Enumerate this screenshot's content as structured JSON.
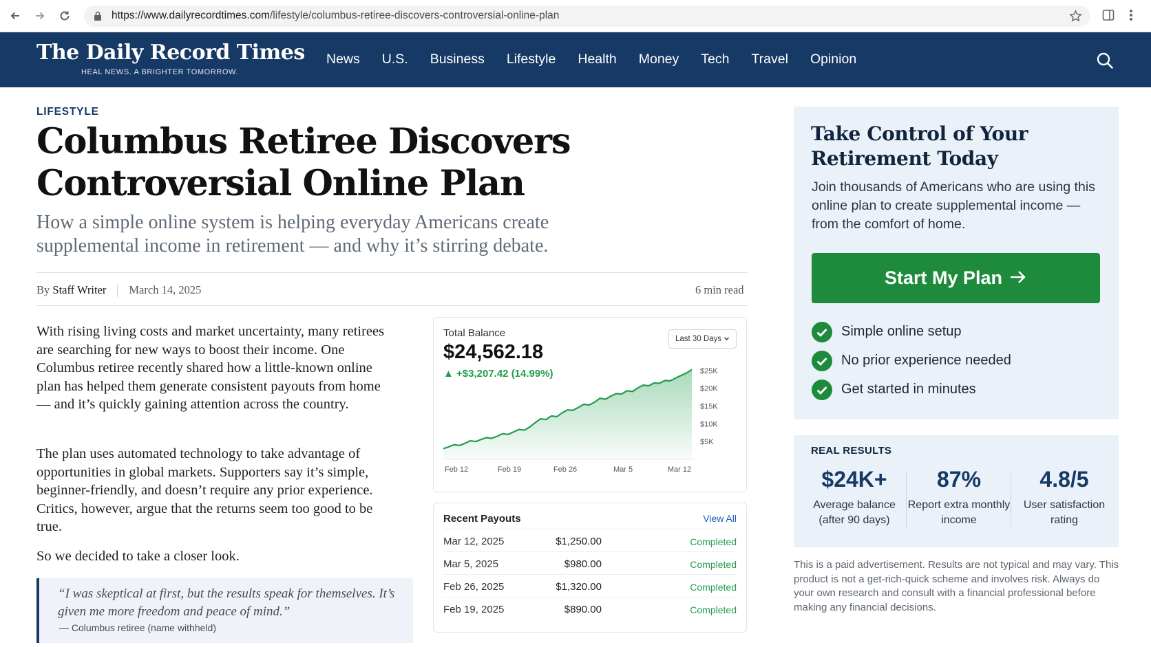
{
  "browser": {
    "url_host": "https://www.dailyrecordtimes.com",
    "url_path": "/lifestyle/columbus-retiree-discovers-controversial-online-plan"
  },
  "site": {
    "name": "The Daily Record Times",
    "tagline": "HEAL NEWS. A BRIGHTER TOMORROW.",
    "nav": [
      "News",
      "U.S.",
      "Business",
      "Lifestyle",
      "Health",
      "Money",
      "Tech",
      "Travel",
      "Opinion"
    ]
  },
  "article": {
    "kicker": "LIFESTYLE",
    "headline": "Columbus Retiree Discovers Controversial Online Plan",
    "subhead": "How a simple online system is helping everyday Americans create supplemental income in retirement — and why it’s stirring debate.",
    "by": "By",
    "author": "Staff Writer",
    "date": "March 14, 2025",
    "read_time": "6 min read",
    "paragraphs": [
      "With rising living costs and market uncertainty, many retirees are searching for new ways to boost their income. One Columbus retiree recently shared how a little-known online plan has helped them generate consistent payouts from home — and it’s quickly gaining attention across the country.",
      "The plan uses automated technology to take advantage of opportunities in global markets. Supporters say it’s simple, beginner-friendly, and doesn’t require any prior experience. Critics, however, argue that the returns seem too good to be true.",
      "So we decided to take a closer look."
    ],
    "quote": "“I was skeptical at first, but the results speak for themselves. It’s given me more freedom and peace of mind.”",
    "quote_attribution": "— Columbus retiree (name withheld)"
  },
  "balance_card": {
    "label": "Total Balance",
    "value": "$24,562.18",
    "change": "+$3,207.42 (14.99%)",
    "range": "Last 30 Days"
  },
  "chart_data": {
    "type": "area",
    "x_ticks": [
      "Feb 12",
      "Feb 19",
      "Feb 26",
      "Mar 5",
      "Mar 12"
    ],
    "y_ticks": [
      "$25K",
      "$20K",
      "$15K",
      "$10K",
      "$5K"
    ],
    "ylim": [
      0,
      27500
    ],
    "grid": false,
    "y_axis_side": "right",
    "color": "#1f9d4c",
    "values": [
      3000,
      3500,
      4100,
      3900,
      4500,
      5200,
      5000,
      5600,
      6100,
      5900,
      6500,
      7200,
      7000,
      7700,
      8400,
      8200,
      9100,
      10300,
      11400,
      11200,
      12200,
      12000,
      13100,
      13900,
      13800,
      14600,
      15500,
      15300,
      16100,
      17200,
      16900,
      17800,
      18500,
      18400,
      19300,
      19100,
      20100,
      20900,
      20700,
      21500,
      21400,
      22200,
      22100,
      22900,
      23600,
      24300,
      25300
    ]
  },
  "payouts": {
    "title": "Recent Payouts",
    "view_all": "View All",
    "rows": [
      {
        "date": "Mar 12, 2025",
        "amount": "$1,250.00",
        "status": "Completed"
      },
      {
        "date": "Mar 5, 2025",
        "amount": "$980.00",
        "status": "Completed"
      },
      {
        "date": "Feb 26, 2025",
        "amount": "$1,320.00",
        "status": "Completed"
      },
      {
        "date": "Feb 19, 2025",
        "amount": "$890.00",
        "status": "Completed"
      }
    ]
  },
  "ad": {
    "title": "Take Control of Your Retirement Today",
    "description": "Join thousands of Americans who are using this online plan to create supplemental income — from the comfort of home.",
    "cta": "Start My Plan",
    "features": [
      "Simple online setup",
      "No prior experience needed",
      "Get started in minutes"
    ]
  },
  "results": {
    "label": "REAL RESULTS",
    "stats": [
      {
        "value": "$24K+",
        "label": "Average balance (after 90 days)"
      },
      {
        "value": "87%",
        "label": "Report extra monthly income"
      },
      {
        "value": "4.8/5",
        "label": "User satisfaction rating"
      }
    ]
  },
  "disclaimer": "This is a paid advertisement. Results are not typical and may vary. This product is not a get-rich-quick scheme and involves risk. Always do your own research and consult with a financial professional before making any financial decisions.",
  "colors": {
    "header_bg": "#163a65",
    "cta_green": "#1d8b3b",
    "positive_green": "#1f9d4c",
    "ad_bg": "#eaf1f8"
  }
}
